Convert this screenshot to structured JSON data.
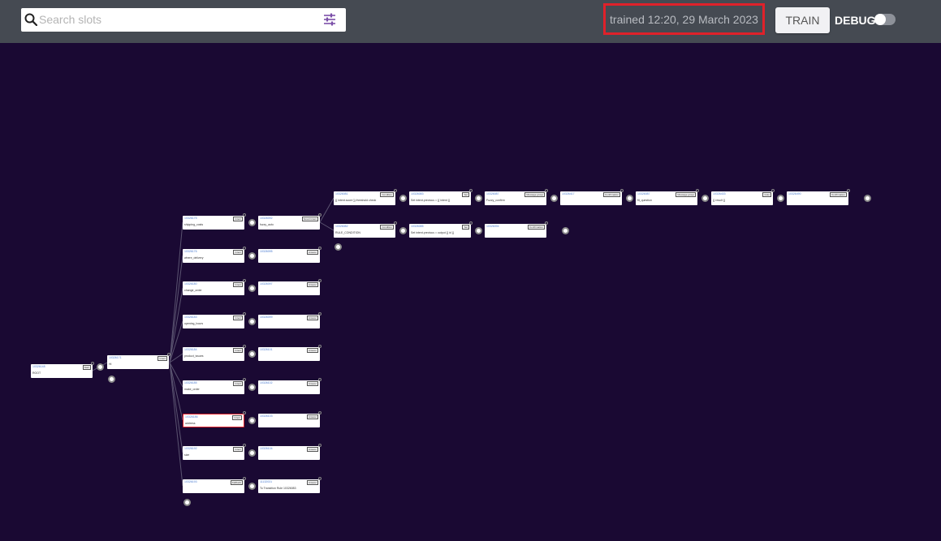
{
  "header": {
    "search_placeholder": "Search slots",
    "trained_text": "trained 12:20, 29 March 2023",
    "train_label": "TRAIN",
    "debug_label": "DEBUG",
    "debug_on": false
  },
  "icons": {
    "search": "search-icon",
    "filter": "filter-sliders-icon",
    "add": "add-circle-icon"
  },
  "colors": {
    "background": "#1a0933",
    "header": "#454a52",
    "highlight": "#e0212a"
  },
  "tree": {
    "root": {
      "id": "10326148",
      "tag": "Start",
      "name": "ROOT"
    },
    "hub": {
      "id": "10326171",
      "tag": "Intent",
      "name": "Hi"
    },
    "rows": [
      {
        "slot": {
          "id": "10326175",
          "tag": "Intent",
          "name": "shipping_costs"
        },
        "next": {
          "id": "10326092",
          "tag": "Smart Intent",
          "name": "fuzzy_auto"
        }
      },
      {
        "slot": {
          "id": "10326176",
          "tag": "Intent",
          "name": "where_delivery"
        },
        "next": {
          "id": "10326095",
          "tag": "Answer",
          "name": ""
        }
      },
      {
        "slot": {
          "id": "10326180",
          "tag": "Intent",
          "name": "change_order"
        },
        "next": {
          "id": "10326097",
          "tag": "Answer",
          "name": ""
        }
      },
      {
        "slot": {
          "id": "10326183",
          "tag": "Intent",
          "name": "opening_hours"
        },
        "next": {
          "id": "10326099",
          "tag": "Answer",
          "name": ""
        }
      },
      {
        "slot": {
          "id": "10326184",
          "tag": "Intent",
          "name": "product_issues"
        },
        "next": {
          "id": "10326101",
          "tag": "Answer",
          "name": ""
        }
      },
      {
        "slot": {
          "id": "10326185",
          "tag": "Intent",
          "name": "make_order"
        },
        "next": {
          "id": "10326102",
          "tag": "Answer",
          "name": ""
        }
      },
      {
        "slot": {
          "id": "10326186",
          "tag": "Intent",
          "name": "address"
        },
        "next": {
          "id": "10326103",
          "tag": "Answer",
          "name": ""
        }
      },
      {
        "slot": {
          "id": "10326192",
          "tag": "Intent",
          "name": "size"
        },
        "next": {
          "id": "10326104",
          "tag": "Answer",
          "name": ""
        }
      },
      {
        "slot": {
          "id": "10326193",
          "tag": "Fallback",
          "name": ""
        },
        "next": {
          "id": "11132031",
          "tag": "Answer",
          "name": "To Transition Rule 10326083"
        }
      }
    ],
    "upper_chain": [
      {
        "id": "10326081",
        "tag": "Condition",
        "name": "{{ intent.score }} threshold check"
      },
      {
        "id": "10326083",
        "tag": "Set",
        "name": "Set intent.previous = {{ intent }}"
      },
      {
        "id": "10326087",
        "tag": "Message group",
        "name": "Fuzzy_confirm"
      },
      {
        "id": "10326417",
        "tag": "Confirmation",
        "name": ""
      },
      {
        "id": "10326087",
        "tag": "Message group",
        "name": "fit_question"
      },
      {
        "id": "10326433",
        "tag": "Goto",
        "name": "{{ result }}"
      },
      {
        "id": "10326490",
        "tag": "Confirmation",
        "name": ""
      }
    ],
    "lower_chain": [
      {
        "id": "10326082",
        "tag": "Condition",
        "name": "RULE_CONDITION"
      },
      {
        "id": "10326085",
        "tag": "Set",
        "name": "Set intent.previous = output {{ id }}"
      },
      {
        "id": "10326094",
        "tag": "Confirmation",
        "name": ""
      }
    ]
  }
}
